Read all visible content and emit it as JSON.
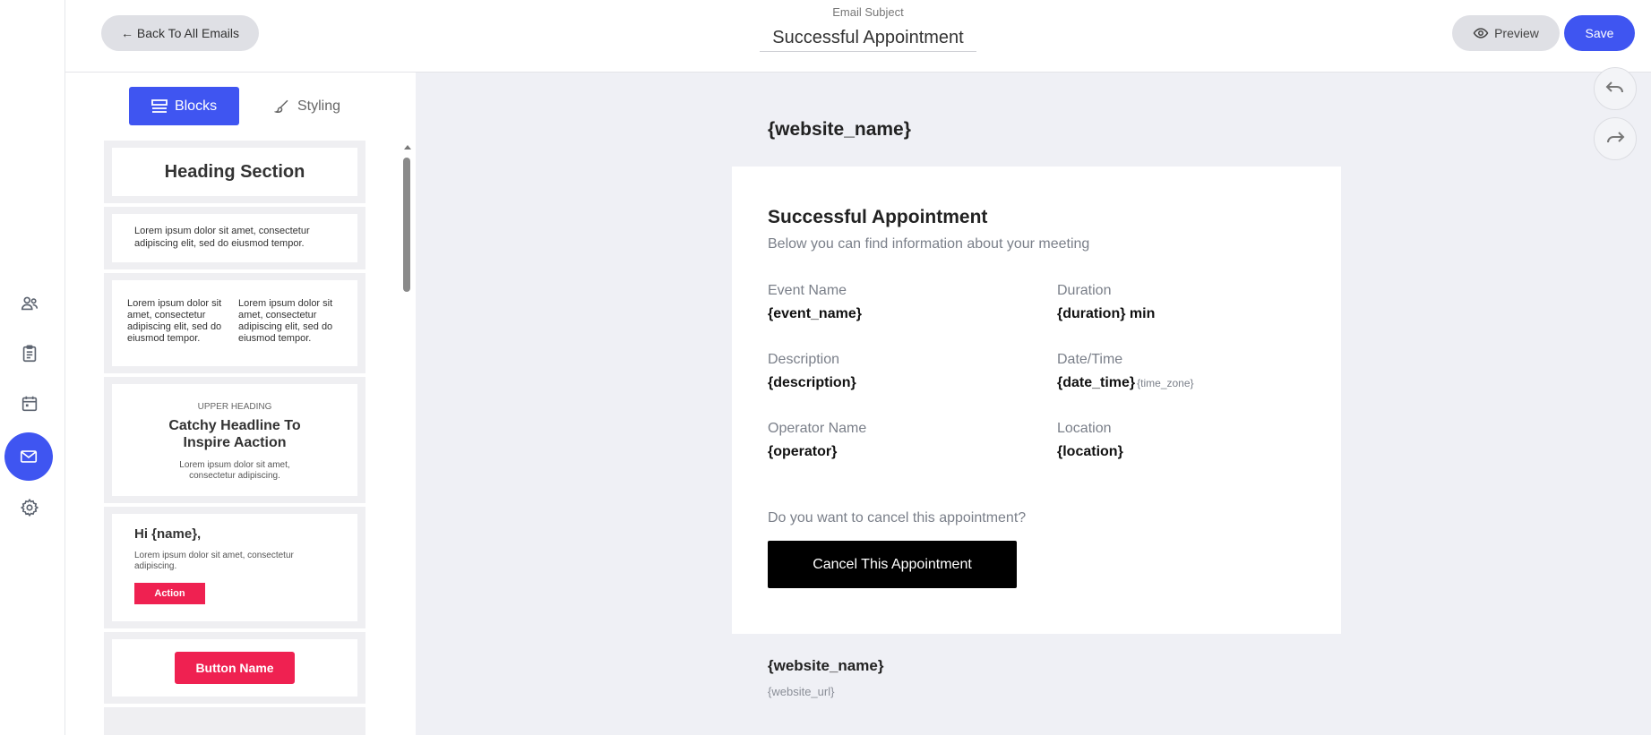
{
  "topbar": {
    "back_label": "← Back To All Emails",
    "subject_label": "Email Subject",
    "subject_value": "Successful Appointment",
    "preview_label": "Preview",
    "save_label": "Save"
  },
  "rail": {
    "items": [
      {
        "icon": "people-icon"
      },
      {
        "icon": "clipboard-icon"
      },
      {
        "icon": "calendar-icon"
      },
      {
        "icon": "mail-icon",
        "active": true
      },
      {
        "icon": "gear-icon"
      }
    ]
  },
  "panel": {
    "tabs": {
      "blocks": "Blocks",
      "styling": "Styling"
    },
    "blocks": {
      "heading": "Heading Section",
      "paragraph": "Lorem ipsum dolor sit amet, consectetur adipiscing elit, sed do eiusmod tempor.",
      "col_left": "Lorem ipsum dolor sit amet, consectetur adipiscing elit, sed do eiusmod tempor.",
      "col_right": "Lorem ipsum dolor sit amet, consectetur adipiscing elit, sed do eiusmod tempor.",
      "upper_heading": "UPPER HEADING",
      "headline": "Catchy Headline To Inspire Aaction",
      "headline_text": "Lorem ipsum dolor sit amet, consectetur adipiscing.",
      "greeting": "Hi {name},",
      "greeting_text": "Lorem ipsum dolor sit amet, consectetur adipiscing.",
      "action_label": "Action",
      "button_name": "Button Name"
    }
  },
  "email": {
    "site_name": "{website_name}",
    "title": "Successful Appointment",
    "subtitle": "Below you can find information about your meeting",
    "fields": {
      "event_name": {
        "label": "Event Name",
        "value": "{event_name}"
      },
      "duration": {
        "label": "Duration",
        "value": "{duration} min"
      },
      "description": {
        "label": "Description",
        "value": "{description}"
      },
      "date_time": {
        "label": "Date/Time",
        "value": "{date_time}",
        "extra": "{time_zone}"
      },
      "operator": {
        "label": "Operator Name",
        "value": "{operator}"
      },
      "location": {
        "label": "Location",
        "value": "{location}"
      }
    },
    "cancel_question": "Do you want to cancel this appointment?",
    "cancel_button": "Cancel This Appointment",
    "footer_site_name": "{website_name}",
    "footer_url": "{website_url}"
  },
  "colors": {
    "accent": "#3f55f1",
    "danger": "#ef2151",
    "canvas_bg": "#eff0f5"
  }
}
